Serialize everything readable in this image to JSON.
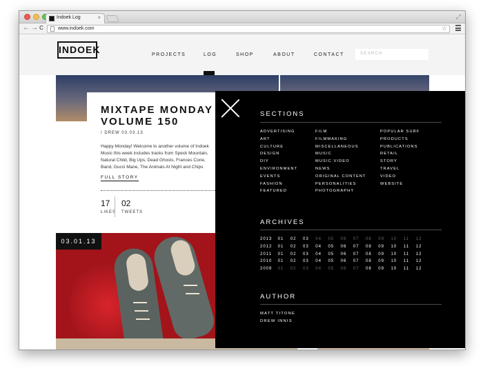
{
  "browser": {
    "tab_title": "Indoek Log",
    "tab_close": "×",
    "url": "www.indoek.com",
    "back": "←",
    "forward": "→",
    "reload": "C"
  },
  "site": {
    "logo": "INDOEK",
    "nav": [
      "PROJECTS",
      "LOG",
      "SHOP",
      "ABOUT",
      "CONTACT"
    ],
    "active_nav": "LOG",
    "search_placeholder": "SEARCH"
  },
  "article": {
    "title_line1": "MIXTAPE MONDAY",
    "title_line2": "VOLUME 150",
    "meta": "/ DREW 03.03.13",
    "body": "Happy Monday! Welcome to another volume of Indoek\nMusic this week includes tracks from Speck Mountain,\nNatural Child, Big Ups, Dead Ghosts, Frances Cone,\nBand, Gucci Mane, The Animals At Night and Chips",
    "full_story": "FULL STORY",
    "likes_count": "17",
    "likes_label": "LIKES",
    "tweets_count": "02",
    "tweets_label": "TWEETS"
  },
  "post2": {
    "date": "03.01.13"
  },
  "overlay": {
    "sections_heading": "SECTIONS",
    "sections_col1": [
      "ADVERTISING",
      "ART",
      "CULTURE",
      "DESIGN",
      "DIY",
      "ENVIRONMENT",
      "EVENTS",
      "FASHION",
      "FEATURED"
    ],
    "sections_col2": [
      "FILM",
      "FILMMAKING",
      "MISCELLANEOUS",
      "MUSIC",
      "MUSIC VIDEO",
      "NEWS",
      "ORIGINAL CONTENT",
      "PERSONALITIES",
      "PHOTOGRAPHY"
    ],
    "sections_col3": [
      "POPULAR SURF",
      "PRODUCTS",
      "PUBLICATIONS",
      "RETAIL",
      "STORY",
      "TRAVEL",
      "VIDEO",
      "WEBSITE"
    ],
    "archives_heading": "ARCHIVES",
    "archives": [
      {
        "year": "2013",
        "months": [
          "01",
          "02",
          "03",
          "04",
          "05",
          "06",
          "07",
          "08",
          "09",
          "10",
          "11",
          "12"
        ],
        "active": 3
      },
      {
        "year": "2012",
        "months": [
          "01",
          "02",
          "03",
          "04",
          "05",
          "06",
          "07",
          "08",
          "09",
          "10",
          "11",
          "12"
        ],
        "active": 12
      },
      {
        "year": "2011",
        "months": [
          "01",
          "02",
          "03",
          "04",
          "05",
          "06",
          "07",
          "08",
          "09",
          "10",
          "11",
          "12"
        ],
        "active": 12
      },
      {
        "year": "2010",
        "months": [
          "01",
          "02",
          "03",
          "04",
          "05",
          "06",
          "07",
          "08",
          "09",
          "10",
          "11",
          "12"
        ],
        "active": 12
      },
      {
        "year": "2009",
        "months": [
          "01",
          "02",
          "03",
          "04",
          "05",
          "06",
          "07",
          "08",
          "09",
          "10",
          "11",
          "12"
        ],
        "active_from": 8
      }
    ],
    "author_heading": "AUTHOR",
    "authors": [
      "MATT TITONE",
      "DREW INNIS"
    ]
  }
}
